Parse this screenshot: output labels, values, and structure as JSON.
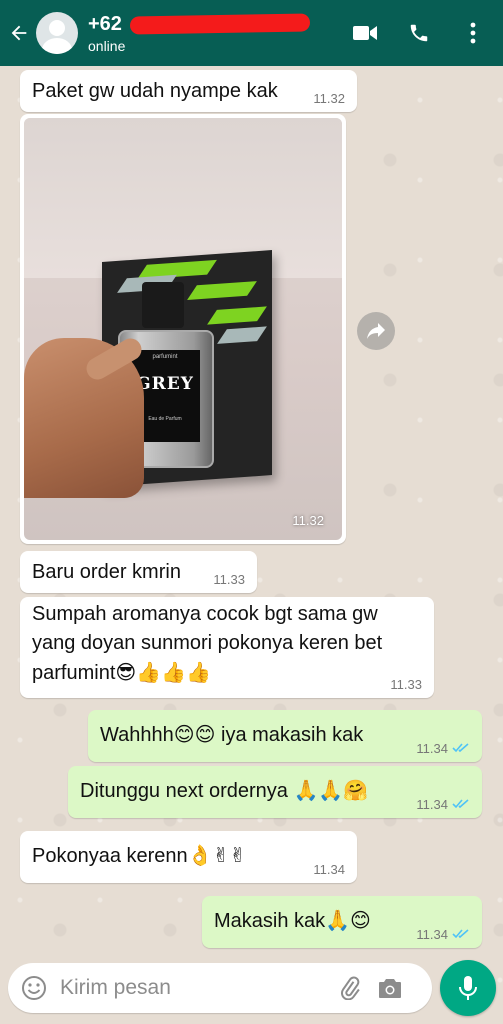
{
  "header": {
    "contact_name": "+62",
    "status": "online",
    "colors": {
      "header_bg": "#075e54",
      "outgoing_bubble": "#dcf8c6",
      "read_ticks": "#4fc3f7"
    }
  },
  "messages": [
    {
      "direction": "in",
      "text": "Paket gw udah nyampe kak",
      "time": "11.32"
    },
    {
      "direction": "in",
      "type": "image",
      "time": "11.32",
      "image_text": {
        "brand": "parfumint",
        "title": "GREY",
        "subtitle": "Eau de Parfum"
      }
    },
    {
      "direction": "in",
      "text": "Baru order kmrin",
      "time": "11.33"
    },
    {
      "direction": "in",
      "text_lines": [
        "Sumpah aromanya cocok bgt sama gw",
        "yang doyan sunmori pokonya keren bet"
      ],
      "text_last": "parfumint",
      "emojis": "😎👍👍👍",
      "time": "11.33"
    },
    {
      "direction": "out",
      "text_parts": [
        "Wahhhh",
        "😊😊",
        " iya makasih kak"
      ],
      "time": "11.34",
      "read": true
    },
    {
      "direction": "out",
      "text_parts": [
        "Ditunggu next ordernya ",
        "🙏🙏🤗"
      ],
      "time": "11.34",
      "read": true
    },
    {
      "direction": "in",
      "text_parts": [
        "Pokonyaa kerenn",
        "👌✌✌"
      ],
      "time": "11.34"
    },
    {
      "direction": "out",
      "text_parts": [
        "Makasih kak",
        "🙏😊"
      ],
      "time": "11.34",
      "read": true
    }
  ],
  "composer": {
    "placeholder": "Kirim pesan"
  },
  "icons": [
    "back-arrow-icon",
    "avatar-icon",
    "video-call-icon",
    "phone-icon",
    "more-vert-icon",
    "forward-icon",
    "emoji-icon",
    "attach-icon",
    "camera-icon",
    "mic-icon"
  ]
}
